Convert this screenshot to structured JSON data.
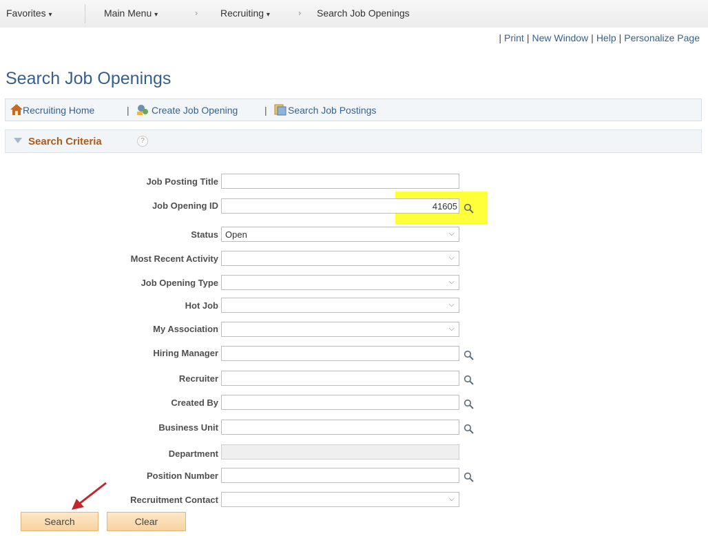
{
  "topnav": {
    "favorites": "Favorites",
    "main_menu": "Main Menu",
    "recruiting": "Recruiting",
    "current": "Search Job Openings"
  },
  "toplinks": {
    "print": "Print",
    "new_window": "New Window",
    "help": "Help",
    "personalize": "Personalize Page"
  },
  "page_title": "Search Job Openings",
  "linkbar": {
    "recruiting_home": "Recruiting Home",
    "create_job_opening": "Create Job Opening",
    "search_job_postings": "Search Job Postings"
  },
  "section": {
    "title": "Search Criteria",
    "help_glyph": "?"
  },
  "fields": {
    "job_posting_title": {
      "label": "Job Posting Title",
      "value": ""
    },
    "job_opening_id": {
      "label": "Job Opening ID",
      "value": "41605"
    },
    "status": {
      "label": "Status",
      "value": "Open"
    },
    "most_recent_activity": {
      "label": "Most Recent Activity",
      "value": ""
    },
    "job_opening_type": {
      "label": "Job Opening Type",
      "value": ""
    },
    "hot_job": {
      "label": "Hot Job",
      "value": ""
    },
    "my_association": {
      "label": "My Association",
      "value": ""
    },
    "hiring_manager": {
      "label": "Hiring Manager",
      "value": ""
    },
    "recruiter": {
      "label": "Recruiter",
      "value": ""
    },
    "created_by": {
      "label": "Created By",
      "value": ""
    },
    "business_unit": {
      "label": "Business Unit",
      "value": ""
    },
    "department": {
      "label": "Department",
      "value": ""
    },
    "position_number": {
      "label": "Position Number",
      "value": ""
    },
    "recruitment_contact": {
      "label": "Recruitment Contact",
      "value": ""
    }
  },
  "buttons": {
    "search": "Search",
    "clear": "Clear"
  },
  "colors": {
    "link": "#375f8c",
    "section_title": "#b05a16",
    "highlight": "#ffff3a",
    "button": "#f7d3a0",
    "arrow": "#c0282d"
  },
  "icons": {
    "lookup": "magnifier-icon",
    "dropdown": "chevron-down-icon",
    "home": "house-icon",
    "create": "create-job-icon",
    "postings": "postings-icon"
  }
}
